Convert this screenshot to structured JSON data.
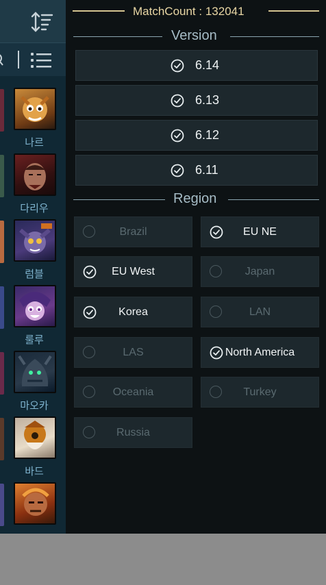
{
  "header": {
    "match_count": "MatchCount : 132041"
  },
  "version": {
    "title": "Version",
    "items": [
      {
        "label": "6.14",
        "checked": true
      },
      {
        "label": "6.13",
        "checked": true
      },
      {
        "label": "6.12",
        "checked": true
      },
      {
        "label": "6.11",
        "checked": true
      }
    ]
  },
  "region": {
    "title": "Region",
    "items": [
      {
        "label": "Brazil",
        "checked": false
      },
      {
        "label": "EU NE",
        "checked": true
      },
      {
        "label": "EU West",
        "checked": true
      },
      {
        "label": "Japan",
        "checked": false
      },
      {
        "label": "Korea",
        "checked": true
      },
      {
        "label": "LAN",
        "checked": false
      },
      {
        "label": "LAS",
        "checked": false
      },
      {
        "label": "North America",
        "checked": true
      },
      {
        "label": "Oceania",
        "checked": false
      },
      {
        "label": "Turkey",
        "checked": false
      },
      {
        "label": "Russia",
        "checked": false
      }
    ]
  },
  "background_list": {
    "champions": [
      {
        "name": "나르"
      },
      {
        "name": "다리우"
      },
      {
        "name": "럼블"
      },
      {
        "name": "룰루"
      },
      {
        "name": "마오카"
      },
      {
        "name": "바드"
      },
      {
        "name": ""
      }
    ]
  },
  "colors": {
    "accent_gold": "#d4c490",
    "drawer_bg": "#0d1214",
    "button_bg": "#1d282d",
    "champion_name": "#7fb4cf"
  }
}
